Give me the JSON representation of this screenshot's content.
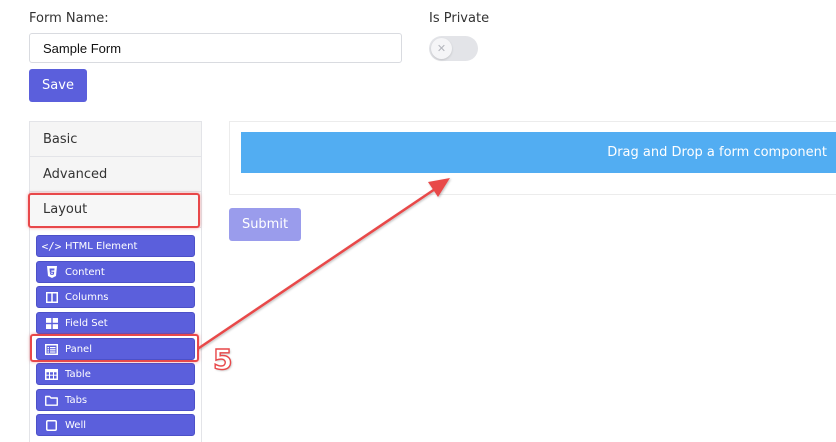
{
  "form": {
    "name_label": "Form Name:",
    "name_value": "Sample Form",
    "private_label": "Is Private",
    "private_on": false,
    "save_label": "Save"
  },
  "sidebar": {
    "groups": [
      "Basic",
      "Advanced",
      "Layout"
    ],
    "components": [
      {
        "label": "HTML Element",
        "icon": "code-icon"
      },
      {
        "label": "Content",
        "icon": "html5-icon"
      },
      {
        "label": "Columns",
        "icon": "columns-icon"
      },
      {
        "label": "Field Set",
        "icon": "th-large-icon"
      },
      {
        "label": "Panel",
        "icon": "list-alt-icon"
      },
      {
        "label": "Table",
        "icon": "table-icon"
      },
      {
        "label": "Tabs",
        "icon": "folder-icon"
      },
      {
        "label": "Well",
        "icon": "square-icon"
      }
    ]
  },
  "canvas": {
    "drop_text": "Drag and Drop a form component",
    "submit_label": "Submit"
  },
  "annotation": {
    "step": "5",
    "color": "#e8484a"
  },
  "colors": {
    "primary": "#5b5fdc",
    "drop_bar": "#52adf2",
    "submit_disabled": "#9a9cec"
  }
}
